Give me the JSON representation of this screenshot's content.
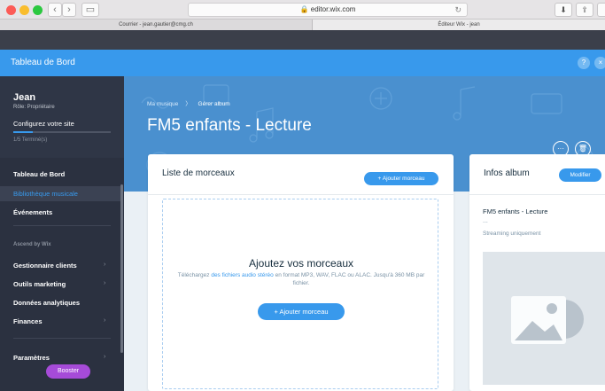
{
  "browser": {
    "url": "editor.wix.com",
    "lock_icon": "lock-icon",
    "tabs": [
      {
        "label": "Courrier - jean.gautier@cmg.ch"
      },
      {
        "label": "Éditeur Wix - jean"
      }
    ]
  },
  "modal": {
    "title": "Tableau de Bord",
    "help_label": "?",
    "close_label": "×"
  },
  "sidebar": {
    "user_name": "Jean",
    "user_role": "Rôle: Propriétaire",
    "config_label": "Configurez votre site",
    "progress_text": "1/5 Terminé(s)",
    "progress_fraction": 0.2,
    "items": [
      {
        "label": "Tableau de Bord"
      },
      {
        "label": "Bibliothèque musicale"
      },
      {
        "label": "Événements"
      }
    ],
    "section_label": "Ascend by Wix",
    "ascend_items": [
      {
        "label": "Gestionnaire clients"
      },
      {
        "label": "Outils marketing"
      },
      {
        "label": "Données analytiques"
      },
      {
        "label": "Finances"
      }
    ],
    "settings_label": "Paramètres",
    "booster_label": "Booster"
  },
  "hero": {
    "breadcrumb_root": "Ma musique",
    "breadcrumb_current": "Gérer album",
    "album_title": "FM5 enfants - Lecture",
    "more_label": "···",
    "delete_label": "🗑"
  },
  "tracks": {
    "title": "Liste de morceaux",
    "add_small": "+ Ajouter morceau",
    "dz_title": "Ajoutez vos morceaux",
    "dz_desc_prefix": "Téléchargez ",
    "dz_link": "des fichiers audio stéréo",
    "dz_desc_suffix": " en format MP3, WAV, FLAC ou ALAC. Jusqu'à 360 MB par fichier.",
    "add_big": "+ Ajouter morceau"
  },
  "album_info": {
    "title": "Infos album",
    "modify_label": "Modifier",
    "name": "FM5 enfants - Lecture",
    "dots": "...",
    "status": "Streaming uniquement"
  },
  "colors": {
    "accent": "#3899ec",
    "sidebar": "#2b3140",
    "booster": "#a64bd8"
  }
}
